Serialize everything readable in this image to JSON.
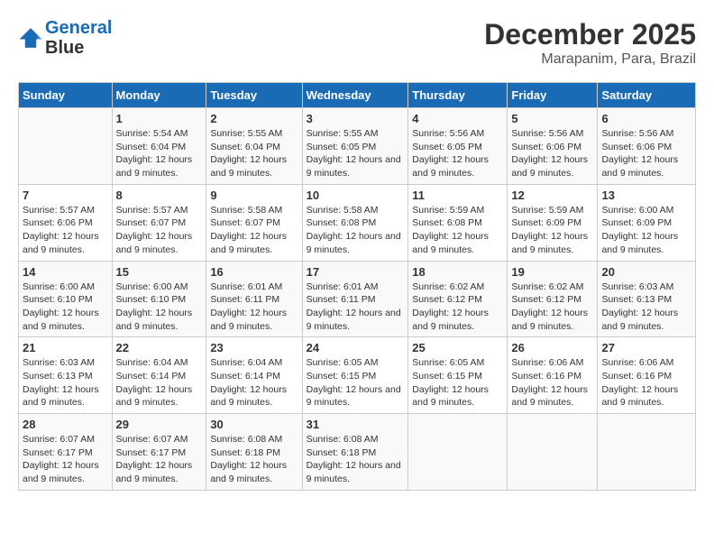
{
  "header": {
    "logo_line1": "General",
    "logo_line2": "Blue",
    "month": "December 2025",
    "location": "Marapanim, Para, Brazil"
  },
  "weekdays": [
    "Sunday",
    "Monday",
    "Tuesday",
    "Wednesday",
    "Thursday",
    "Friday",
    "Saturday"
  ],
  "weeks": [
    [
      {
        "day": "",
        "sunrise": "",
        "sunset": "",
        "daylight": ""
      },
      {
        "day": "1",
        "sunrise": "Sunrise: 5:54 AM",
        "sunset": "Sunset: 6:04 PM",
        "daylight": "Daylight: 12 hours and 9 minutes."
      },
      {
        "day": "2",
        "sunrise": "Sunrise: 5:55 AM",
        "sunset": "Sunset: 6:04 PM",
        "daylight": "Daylight: 12 hours and 9 minutes."
      },
      {
        "day": "3",
        "sunrise": "Sunrise: 5:55 AM",
        "sunset": "Sunset: 6:05 PM",
        "daylight": "Daylight: 12 hours and 9 minutes."
      },
      {
        "day": "4",
        "sunrise": "Sunrise: 5:56 AM",
        "sunset": "Sunset: 6:05 PM",
        "daylight": "Daylight: 12 hours and 9 minutes."
      },
      {
        "day": "5",
        "sunrise": "Sunrise: 5:56 AM",
        "sunset": "Sunset: 6:06 PM",
        "daylight": "Daylight: 12 hours and 9 minutes."
      },
      {
        "day": "6",
        "sunrise": "Sunrise: 5:56 AM",
        "sunset": "Sunset: 6:06 PM",
        "daylight": "Daylight: 12 hours and 9 minutes."
      }
    ],
    [
      {
        "day": "7",
        "sunrise": "Sunrise: 5:57 AM",
        "sunset": "Sunset: 6:06 PM",
        "daylight": "Daylight: 12 hours and 9 minutes."
      },
      {
        "day": "8",
        "sunrise": "Sunrise: 5:57 AM",
        "sunset": "Sunset: 6:07 PM",
        "daylight": "Daylight: 12 hours and 9 minutes."
      },
      {
        "day": "9",
        "sunrise": "Sunrise: 5:58 AM",
        "sunset": "Sunset: 6:07 PM",
        "daylight": "Daylight: 12 hours and 9 minutes."
      },
      {
        "day": "10",
        "sunrise": "Sunrise: 5:58 AM",
        "sunset": "Sunset: 6:08 PM",
        "daylight": "Daylight: 12 hours and 9 minutes."
      },
      {
        "day": "11",
        "sunrise": "Sunrise: 5:59 AM",
        "sunset": "Sunset: 6:08 PM",
        "daylight": "Daylight: 12 hours and 9 minutes."
      },
      {
        "day": "12",
        "sunrise": "Sunrise: 5:59 AM",
        "sunset": "Sunset: 6:09 PM",
        "daylight": "Daylight: 12 hours and 9 minutes."
      },
      {
        "day": "13",
        "sunrise": "Sunrise: 6:00 AM",
        "sunset": "Sunset: 6:09 PM",
        "daylight": "Daylight: 12 hours and 9 minutes."
      }
    ],
    [
      {
        "day": "14",
        "sunrise": "Sunrise: 6:00 AM",
        "sunset": "Sunset: 6:10 PM",
        "daylight": "Daylight: 12 hours and 9 minutes."
      },
      {
        "day": "15",
        "sunrise": "Sunrise: 6:00 AM",
        "sunset": "Sunset: 6:10 PM",
        "daylight": "Daylight: 12 hours and 9 minutes."
      },
      {
        "day": "16",
        "sunrise": "Sunrise: 6:01 AM",
        "sunset": "Sunset: 6:11 PM",
        "daylight": "Daylight: 12 hours and 9 minutes."
      },
      {
        "day": "17",
        "sunrise": "Sunrise: 6:01 AM",
        "sunset": "Sunset: 6:11 PM",
        "daylight": "Daylight: 12 hours and 9 minutes."
      },
      {
        "day": "18",
        "sunrise": "Sunrise: 6:02 AM",
        "sunset": "Sunset: 6:12 PM",
        "daylight": "Daylight: 12 hours and 9 minutes."
      },
      {
        "day": "19",
        "sunrise": "Sunrise: 6:02 AM",
        "sunset": "Sunset: 6:12 PM",
        "daylight": "Daylight: 12 hours and 9 minutes."
      },
      {
        "day": "20",
        "sunrise": "Sunrise: 6:03 AM",
        "sunset": "Sunset: 6:13 PM",
        "daylight": "Daylight: 12 hours and 9 minutes."
      }
    ],
    [
      {
        "day": "21",
        "sunrise": "Sunrise: 6:03 AM",
        "sunset": "Sunset: 6:13 PM",
        "daylight": "Daylight: 12 hours and 9 minutes."
      },
      {
        "day": "22",
        "sunrise": "Sunrise: 6:04 AM",
        "sunset": "Sunset: 6:14 PM",
        "daylight": "Daylight: 12 hours and 9 minutes."
      },
      {
        "day": "23",
        "sunrise": "Sunrise: 6:04 AM",
        "sunset": "Sunset: 6:14 PM",
        "daylight": "Daylight: 12 hours and 9 minutes."
      },
      {
        "day": "24",
        "sunrise": "Sunrise: 6:05 AM",
        "sunset": "Sunset: 6:15 PM",
        "daylight": "Daylight: 12 hours and 9 minutes."
      },
      {
        "day": "25",
        "sunrise": "Sunrise: 6:05 AM",
        "sunset": "Sunset: 6:15 PM",
        "daylight": "Daylight: 12 hours and 9 minutes."
      },
      {
        "day": "26",
        "sunrise": "Sunrise: 6:06 AM",
        "sunset": "Sunset: 6:16 PM",
        "daylight": "Daylight: 12 hours and 9 minutes."
      },
      {
        "day": "27",
        "sunrise": "Sunrise: 6:06 AM",
        "sunset": "Sunset: 6:16 PM",
        "daylight": "Daylight: 12 hours and 9 minutes."
      }
    ],
    [
      {
        "day": "28",
        "sunrise": "Sunrise: 6:07 AM",
        "sunset": "Sunset: 6:17 PM",
        "daylight": "Daylight: 12 hours and 9 minutes."
      },
      {
        "day": "29",
        "sunrise": "Sunrise: 6:07 AM",
        "sunset": "Sunset: 6:17 PM",
        "daylight": "Daylight: 12 hours and 9 minutes."
      },
      {
        "day": "30",
        "sunrise": "Sunrise: 6:08 AM",
        "sunset": "Sunset: 6:18 PM",
        "daylight": "Daylight: 12 hours and 9 minutes."
      },
      {
        "day": "31",
        "sunrise": "Sunrise: 6:08 AM",
        "sunset": "Sunset: 6:18 PM",
        "daylight": "Daylight: 12 hours and 9 minutes."
      },
      {
        "day": "",
        "sunrise": "",
        "sunset": "",
        "daylight": ""
      },
      {
        "day": "",
        "sunrise": "",
        "sunset": "",
        "daylight": ""
      },
      {
        "day": "",
        "sunrise": "",
        "sunset": "",
        "daylight": ""
      }
    ]
  ]
}
